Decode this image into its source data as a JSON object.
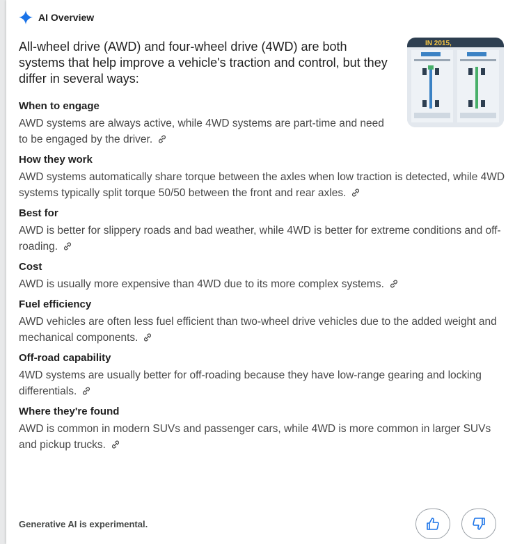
{
  "header": {
    "title": "AI Overview",
    "icon": "sparkle-icon",
    "accent": "#1a73e8"
  },
  "intro": "All-wheel drive (AWD) and four-wheel drive (4WD) are both systems that help improve a vehicle's traction and control, but they differ in several ways:",
  "thumbnail": {
    "caption": "IN 2015,"
  },
  "sections": [
    {
      "title": "When to engage",
      "body": "AWD systems are always active, while 4WD systems are part-time and need to be engaged by the driver."
    },
    {
      "title": "How they work",
      "body": "AWD systems automatically share torque between the axles when low traction is detected, while 4WD systems typically split torque 50/50 between the front and rear axles."
    },
    {
      "title": "Best for",
      "body": "AWD is better for slippery roads and bad weather, while 4WD is better for extreme conditions and off-roading."
    },
    {
      "title": "Cost",
      "body": "AWD is usually more expensive than 4WD due to its more complex systems."
    },
    {
      "title": "Fuel efficiency",
      "body": "AWD vehicles are often less fuel efficient than two-wheel drive vehicles due to the added weight and mechanical components."
    },
    {
      "title": "Off-road capability",
      "body": "4WD systems are usually better for off-roading because they have low-range gearing and locking differentials."
    },
    {
      "title": "Where they're found",
      "body": "AWD is common in modern SUVs and passenger cars, while 4WD is more common in larger SUVs and pickup trucks."
    }
  ],
  "footer": {
    "disclaimer": "Generative AI is experimental.",
    "thumbs_up_icon": "thumbs-up-icon",
    "thumbs_down_icon": "thumbs-down-icon"
  }
}
